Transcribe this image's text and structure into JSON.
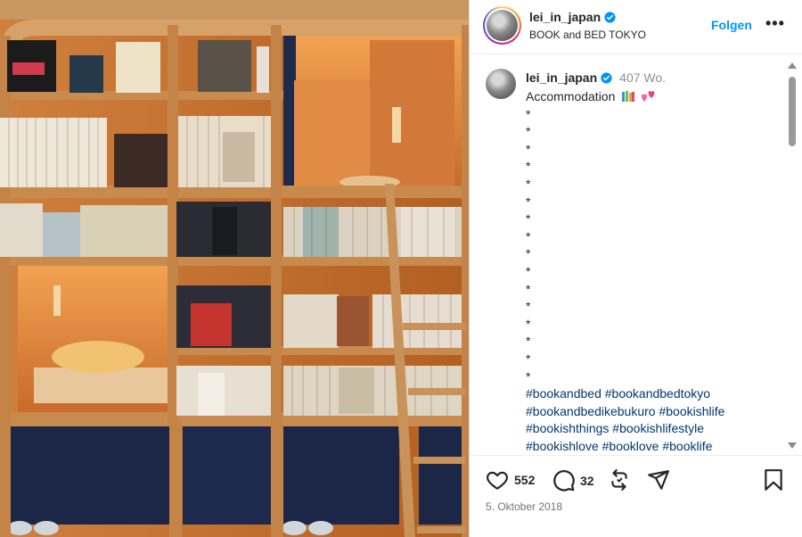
{
  "post": {
    "username": "lei_in_japan",
    "location": "BOOK and BED TOKYO",
    "follow_label": "Folgen",
    "more_label": "•••"
  },
  "caption": {
    "username": "lei_in_japan",
    "time": "407 Wo.",
    "text": "Accommodation",
    "emoji": [
      "books-emoji",
      "two-hearts-emoji"
    ],
    "dots": [
      "*",
      "*",
      "*",
      "*",
      "*",
      "*",
      "*",
      "*",
      "*",
      "*",
      "*",
      "*",
      "*",
      "*",
      "*",
      "*"
    ],
    "hashtag_lines": [
      [
        "#bookandbed",
        "#bookandbedtokyo"
      ],
      [
        "#bookandbedikebukuro",
        "#bookishlife"
      ],
      [
        "#bookishthings",
        "#bookishlifestyle"
      ],
      [
        "#bookishlove",
        "#booklove",
        "#booklife"
      ]
    ]
  },
  "actions": {
    "likes": "552",
    "comments": "32",
    "icons": [
      "heart-icon",
      "comment-icon",
      "repost-icon",
      "share-icon",
      "bookmark-icon"
    ]
  },
  "date": "5. Oktober 2018",
  "colors": {
    "accent": "#0095f6",
    "hashtag": "#00376b",
    "verified": "#0095f6",
    "wood": "#c98a4e"
  }
}
